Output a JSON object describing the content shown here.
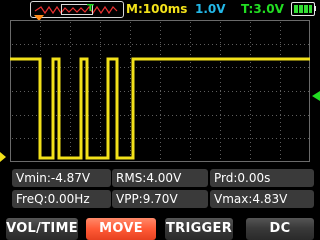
{
  "topbar": {
    "mini_trigger_label": "T",
    "timebase": "M:100ms",
    "volts_div": "1.0V",
    "trigger_level": "T:3.0V",
    "battery_icon": "battery-full-icon"
  },
  "colors": {
    "background": "#000000",
    "grid": "#6a6a6a",
    "trace": "#f2e11a",
    "timebase_text": "#f2e11a",
    "voltsdiv_text": "#23b8e8",
    "trigger_text": "#22dd22",
    "trigger_marker": "#ff8a1a",
    "active_button": "#ff5a36"
  },
  "measurements": {
    "vmin": "Vmin:-4.87V",
    "rms": "RMS:4.00V",
    "prd": "Prd:0.00s",
    "freq": "FreQ:0.00Hz",
    "vpp": "VPP:9.70V",
    "vmax": "Vmax:4.83V"
  },
  "buttons": {
    "vol_time": "VOL/TIME",
    "move": "MOVE",
    "trigger": "TRIGGER",
    "coupling": "DC"
  },
  "active_button": "MOVE"
}
